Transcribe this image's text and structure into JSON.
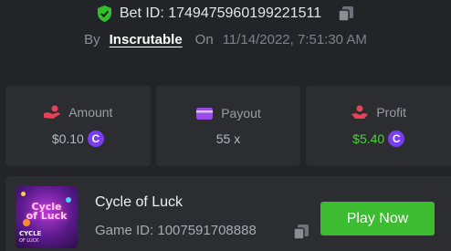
{
  "bet": {
    "id_text": "Bet ID: 1749475960199221511"
  },
  "meta": {
    "by_label": "By",
    "author": "Inscrutable",
    "on_label": "On",
    "date": "11/14/2022, 7:51:30 AM"
  },
  "stats": {
    "amount": {
      "label": "Amount",
      "value": "$0.10",
      "icon": "hand-coin-icon"
    },
    "payout": {
      "label": "Payout",
      "value": "55 x",
      "icon": "wallet-icon"
    },
    "profit": {
      "label": "Profit",
      "value": "$5.40",
      "icon": "profit-hand-icon"
    }
  },
  "coin_symbol": "C",
  "game": {
    "name": "Cycle of Luck",
    "id_text": "Game ID: 1007591708888",
    "play_label": "Play Now",
    "thumb_title_1": "Cycle",
    "thumb_title_2": "of Luck",
    "thumb_sub": "CYCLE",
    "thumb_sub2": "OF LUCK"
  },
  "colors": {
    "background": "#232428",
    "card": "#2b2d31",
    "accent_green": "#3ebc31",
    "profit_green": "#4fd13c",
    "coin_purple": "#7b3df2",
    "icon_red": "#e8425a",
    "icon_purple": "#9b4dea"
  }
}
